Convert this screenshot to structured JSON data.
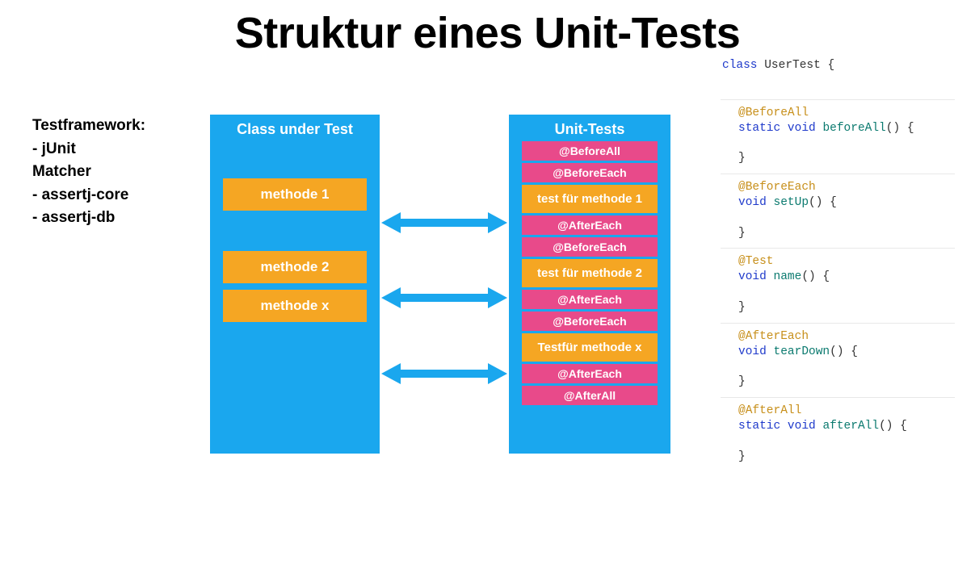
{
  "title": "Struktur eines Unit-Tests",
  "sidebar": {
    "heading1": "Testframework:",
    "item1": "-  jUnit",
    "heading2": "Matcher",
    "item2": "-  assertj-core",
    "item3": "-  assertj-db"
  },
  "left_panel": {
    "title": "Class under Test",
    "methods": [
      "methode 1",
      "methode 2",
      "methode x"
    ]
  },
  "right_panel": {
    "title": "Unit-Tests",
    "rows": [
      {
        "kind": "pink",
        "label": "@BeforeAll"
      },
      {
        "kind": "pink",
        "label": "@BeforeEach"
      },
      {
        "kind": "orange",
        "label": "test für methode 1"
      },
      {
        "kind": "pink",
        "label": "@AfterEach"
      },
      {
        "kind": "pink",
        "label": "@BeforeEach"
      },
      {
        "kind": "orange",
        "label": "test für methode 2"
      },
      {
        "kind": "pink",
        "label": "@AfterEach"
      },
      {
        "kind": "pink",
        "label": "@BeforeEach"
      },
      {
        "kind": "orange",
        "label": "Testfür methode x"
      },
      {
        "kind": "pink",
        "label": "@AfterEach"
      },
      {
        "kind": "pink",
        "label": "@AfterAll"
      }
    ]
  },
  "code": {
    "class_kw": "class",
    "class_name": "UserTest",
    "open": " {",
    "close": "}",
    "static_kw": "static",
    "void_kw": "void",
    "paren": "()",
    "blocks": [
      {
        "ann": "@BeforeAll",
        "static": true,
        "fn": "beforeAll"
      },
      {
        "ann": "@BeforeEach",
        "static": false,
        "fn": "setUp"
      },
      {
        "ann": "@Test",
        "static": false,
        "fn": "name"
      },
      {
        "ann": "@AfterEach",
        "static": false,
        "fn": "tearDown"
      },
      {
        "ann": "@AfterAll",
        "static": true,
        "fn": "afterAll"
      }
    ]
  }
}
